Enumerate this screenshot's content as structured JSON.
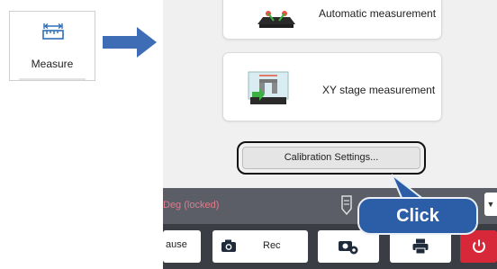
{
  "tile": {
    "label": "Measure",
    "icon": "ruler-measure-icon"
  },
  "arrow": {
    "icon": "right-arrow-icon",
    "color": "#3f6db5"
  },
  "cards": {
    "automatic_label": "Automatic measurement",
    "xy_label": "XY stage measurement"
  },
  "calibration_button": "Calibration Settings...",
  "status_bar": {
    "locked_text": "Deg (locked)",
    "dropdown_icon": "dropdown-arrow-icon"
  },
  "toolbar": {
    "pause_label": "ause",
    "rec_label": "Rec",
    "camera_icon": "camera-icon",
    "camera_settings_icon": "camera-settings-icon",
    "print_icon": "printer-icon",
    "power_icon": "power-icon"
  },
  "callout": {
    "label": "Click",
    "color": "#2c5ea8"
  }
}
